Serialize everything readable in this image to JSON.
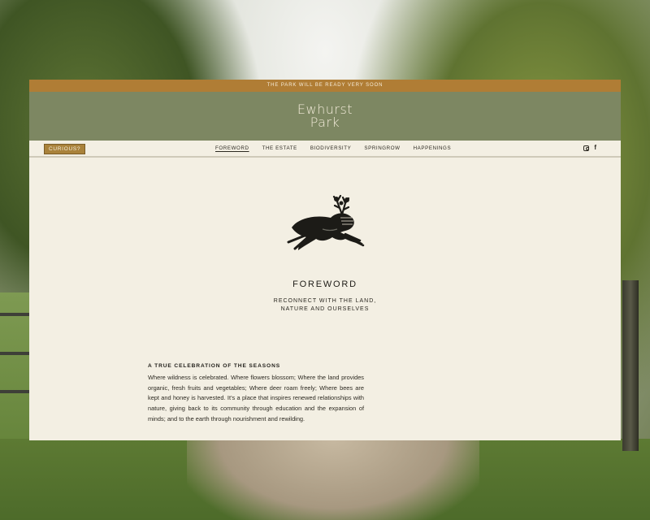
{
  "announcement": "THE PARK WILL BE READY VERY SOON",
  "logo": {
    "line1": "Ewhurst",
    "line2": "Park"
  },
  "nav": {
    "curious_label": "CURIOUS?",
    "items": [
      {
        "label": "FOREWORD",
        "active": true
      },
      {
        "label": "THE ESTATE"
      },
      {
        "label": "BIODIVERSITY"
      },
      {
        "label": "SPRINGROW"
      },
      {
        "label": "HAPPENINGS"
      }
    ],
    "social": [
      "instagram-icon",
      "facebook-icon"
    ],
    "facebook_glyph": "f"
  },
  "hero": {
    "title": "FOREWORD",
    "subtitle_line1": "RECONNECT WITH THE LAND,",
    "subtitle_line2": "NATURE AND OURSELVES"
  },
  "article": {
    "heading": "A TRUE CELEBRATION OF THE SEASONS",
    "body": "Where wildness is celebrated. Where flowers blossom; Where the land provides organic, fresh fruits and vegetables; Where deer roam freely; Where bees are kept and honey is harvested. It’s a place that inspires renewed relationships with nature, giving back to its community through education and the expansion of minds; and to the earth through nourishment and rewilding."
  },
  "colors": {
    "announcement_bar": "#b07d35",
    "masthead": "#7d8762",
    "panel": "#f3efe3",
    "curious_button": "#a9823b"
  }
}
